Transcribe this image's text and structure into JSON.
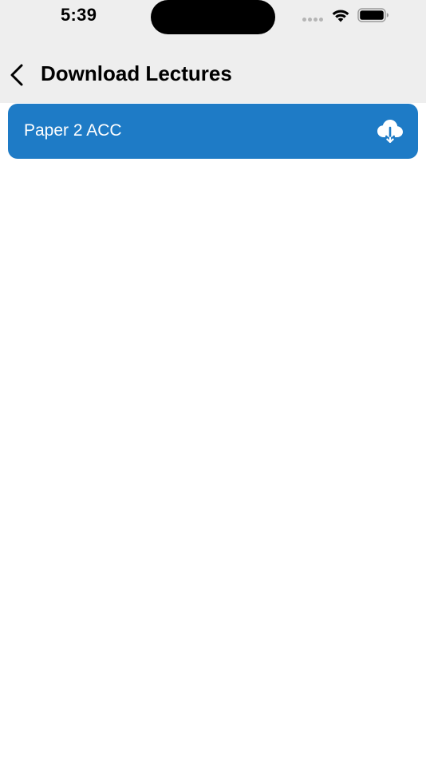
{
  "status_bar": {
    "time": "5:39"
  },
  "nav": {
    "back_icon": "chevron-left-icon",
    "title": "Download Lectures"
  },
  "lectures": [
    {
      "label": "Paper 2 ACC",
      "action_icon": "cloud-download-icon"
    }
  ],
  "colors": {
    "header_background": "#eeeeee",
    "item_background": "#1e7bc6",
    "item_text": "#ffffff",
    "page_background": "#ffffff"
  }
}
